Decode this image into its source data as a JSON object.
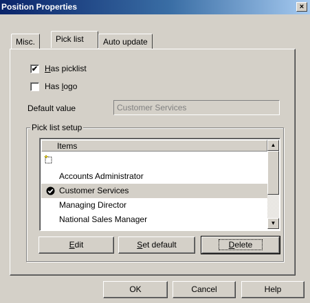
{
  "window": {
    "title": "Position Properties",
    "close_glyph": "×"
  },
  "tabs": [
    {
      "label": "Misc."
    },
    {
      "label": "Pick list",
      "active": true
    },
    {
      "label": "Auto update"
    }
  ],
  "options": {
    "has_picklist": {
      "label_ul": "H",
      "label_rest": "as picklist",
      "checked": true,
      "glyph": "✔"
    },
    "has_logo": {
      "label_pre": "Has ",
      "label_ul": "l",
      "label_rest": "ogo",
      "checked": false
    }
  },
  "default_value": {
    "label": "Default value",
    "value": "Customer Services"
  },
  "picklist": {
    "group_label": "Pick list setup",
    "column_header": "Items",
    "new_item_icon": "new-item-sparkle-icon",
    "default_icon": "check-circle-icon",
    "items": [
      {
        "label": "Accounts Administrator",
        "selected": false,
        "is_default": false
      },
      {
        "label": "Customer Services",
        "selected": true,
        "is_default": true
      },
      {
        "label": "Managing Director",
        "selected": false,
        "is_default": false
      },
      {
        "label": "National Sales Manager",
        "selected": false,
        "is_default": false
      }
    ],
    "scroll_up_glyph": "▲",
    "scroll_down_glyph": "▼"
  },
  "list_buttons": {
    "edit": {
      "ul": "E",
      "rest": "dit"
    },
    "set_default": {
      "ul": "S",
      "rest": "et default"
    },
    "delete": {
      "ul": "D",
      "rest": "elete"
    }
  },
  "dialog_buttons": {
    "ok": "OK",
    "cancel": "Cancel",
    "help": "Help"
  }
}
